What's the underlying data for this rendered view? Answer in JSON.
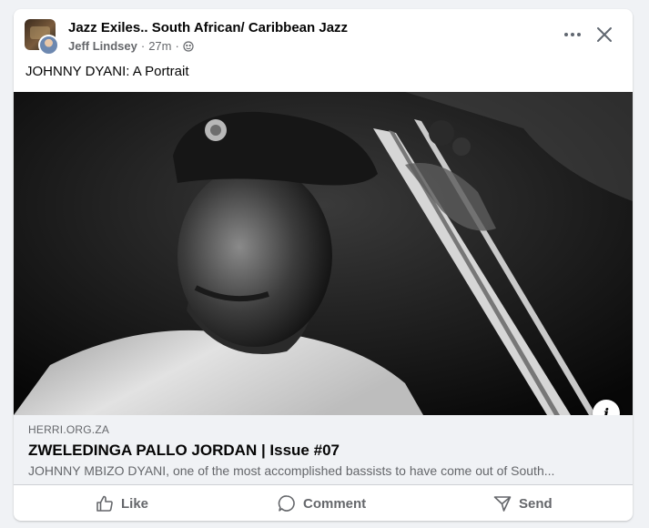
{
  "post": {
    "group_name": "Jazz Exiles.. South African/ Caribbean Jazz",
    "author": "Jeff Lindsey",
    "separator": "·",
    "time": "27m",
    "privacy_icon": "globe-icon",
    "text": "JOHNNY DYANI: A Portrait"
  },
  "link_preview": {
    "domain": "HERRI.ORG.ZA",
    "title": "ZWELEDINGA PALLO JORDAN | Issue #07",
    "description": "JOHNNY MBIZO DYANI, one of the most accomplished bassists to have come out of South...",
    "info_icon_label": "i"
  },
  "actions": {
    "like": "Like",
    "comment": "Comment",
    "send": "Send"
  },
  "icons": {
    "more": "more-options-icon",
    "close": "close-icon",
    "like": "thumbs-up-icon",
    "comment": "comment-bubble-icon",
    "send": "send-icon"
  },
  "colors": {
    "page_bg": "#f0f2f5",
    "card_bg": "#ffffff",
    "primary_text": "#050505",
    "secondary_text": "#65676b"
  }
}
